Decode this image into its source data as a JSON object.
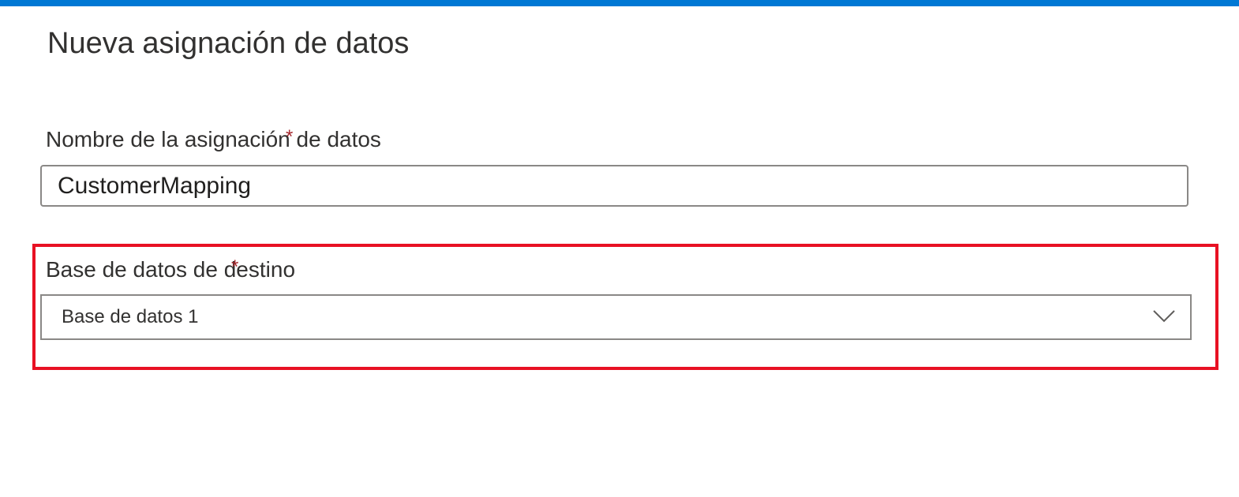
{
  "panel": {
    "title": "Nueva asignación de datos"
  },
  "mapping_name": {
    "label": "Nombre de la asignación de datos",
    "required_marker": "*",
    "value": "CustomerMapping"
  },
  "target_database": {
    "label": "Base de datos de destino",
    "required_marker": "*",
    "selected_value": "Base de datos 1",
    "icon": "chevron-down-icon"
  },
  "colors": {
    "accent": "#0078d4",
    "highlight": "#e81123",
    "required": "#a4262c"
  }
}
